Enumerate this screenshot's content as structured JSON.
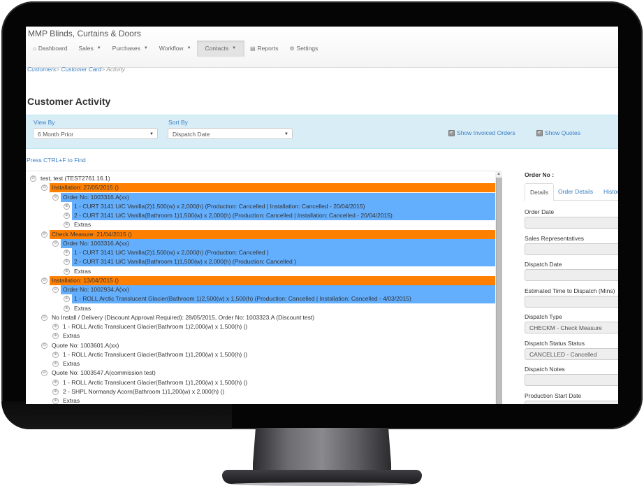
{
  "app": {
    "title": "MMP Blinds, Curtains & Doors"
  },
  "nav": {
    "items": [
      {
        "label": "Dashboard",
        "icon": "home-icon",
        "glyph": "⌂",
        "dropdown": false,
        "active": false
      },
      {
        "label": "Sales",
        "dropdown": true,
        "active": false
      },
      {
        "label": "Purchases",
        "dropdown": true,
        "active": false
      },
      {
        "label": "Workflow",
        "dropdown": true,
        "active": false
      },
      {
        "label": "Contacts",
        "dropdown": true,
        "active": true
      },
      {
        "label": "Reports",
        "icon": "chart-icon",
        "glyph": "▤",
        "dropdown": false,
        "active": false
      },
      {
        "label": "Settings",
        "icon": "gears-icon",
        "glyph": "⚙",
        "dropdown": false,
        "active": false
      }
    ],
    "caret": "▼"
  },
  "breadcrumb": {
    "items": [
      "Customers",
      "Customer Card"
    ],
    "separator": ">",
    "current": "Activity"
  },
  "page": {
    "title": "Customer Activity",
    "find_hint": "Press CTRL+F to Find"
  },
  "filters": {
    "view_by": {
      "label": "View By",
      "value": "6 Month Prior"
    },
    "sort_by": {
      "label": "Sort By",
      "value": "Dispatch Date"
    },
    "dropdown_glyph": "▼",
    "show_invoiced_orders": {
      "label": "Show Invoiced Orders",
      "checked": true
    },
    "show_quotes": {
      "label": "Show Quotes",
      "checked": true
    },
    "check_glyph": "✔"
  },
  "tree": {
    "collapse_glyph": "⊖",
    "expand_glyph": "⊕",
    "rows": [
      {
        "level": 0,
        "type": "customer",
        "text": "test, test (TEST2761.16.1)",
        "state": "collapse"
      },
      {
        "level": 1,
        "type": "dispatch",
        "text": "Installation: 27/05/2015 ()",
        "state": "collapse"
      },
      {
        "level": 2,
        "type": "order",
        "text": "Order No: 1003316.A(xx)",
        "state": "collapse"
      },
      {
        "level": 3,
        "type": "item",
        "text": "1 - CURT 3141 U/C Vanilla(2)1,500(w) x 2,000(h) (Production: Cancelled | Installation: Cancelled - 20/04/2015)",
        "state": "expand"
      },
      {
        "level": 3,
        "type": "item",
        "text": "2 - CURT 3141 U/C Vanilla(Bathroom 1)1,500(w) x 2,000(h) (Production: Cancelled | Installation: Cancelled - 20/04/2015)",
        "state": "expand"
      },
      {
        "level": 3,
        "type": "extras",
        "text": "Extras",
        "state": "expand"
      },
      {
        "level": 1,
        "type": "dispatch",
        "text": "Check Measure: 21/04/2015 ()",
        "state": "collapse"
      },
      {
        "level": 2,
        "type": "order",
        "text": "Order No: 1003316.A(xx)",
        "state": "collapse"
      },
      {
        "level": 3,
        "type": "item",
        "text": "1 - CURT 3141 U/C Vanilla(2)1,500(w) x 2,000(h) (Production: Cancelled )",
        "state": "expand"
      },
      {
        "level": 3,
        "type": "item",
        "text": "2 - CURT 3141 U/C Vanilla(Bathroom 1)1,500(w) x 2,000(h) (Production: Cancelled )",
        "state": "expand"
      },
      {
        "level": 3,
        "type": "extras",
        "text": "Extras",
        "state": "expand"
      },
      {
        "level": 1,
        "type": "dispatch",
        "text": "Installation: 13/04/2015 ()",
        "state": "collapse"
      },
      {
        "level": 2,
        "type": "order",
        "text": "Order No: 1002934.A(xx)",
        "state": "collapse"
      },
      {
        "level": 3,
        "type": "item",
        "text": "1 - ROLL Arctic Translucent Glacier(Bathroom 1)2,500(w) x 1,500(h) (Production: Cancelled | Installation: Cancelled - 4/03/2015)",
        "state": "expand"
      },
      {
        "level": 3,
        "type": "extras",
        "text": "Extras",
        "state": "expand"
      },
      {
        "level": 1,
        "type": "plain",
        "text": "No Install / Delivery (Discount Approval Required): 28/05/2015, Order No: 1003323.A (Discount test)",
        "state": "collapse"
      },
      {
        "level": 2,
        "type": "plain-item",
        "text": "1 - ROLL Arctic Translucent Glacier(Bathroom 1)2,000(w) x 1,500(h) ()",
        "state": "expand"
      },
      {
        "level": 2,
        "type": "plain-item",
        "text": "Extras",
        "state": "expand"
      },
      {
        "level": 1,
        "type": "plain",
        "text": "Quote No: 1003601.A(xx)",
        "state": "collapse"
      },
      {
        "level": 2,
        "type": "plain-item",
        "text": "1 - ROLL Arctic Translucent Glacier(Bathroom 1)1,200(w) x 1,500(h) ()",
        "state": "expand"
      },
      {
        "level": 2,
        "type": "plain-item",
        "text": "Extras",
        "state": "expand"
      },
      {
        "level": 1,
        "type": "plain",
        "text": "Quote No: 1003547.A(commission test)",
        "state": "collapse"
      },
      {
        "level": 2,
        "type": "plain-item",
        "text": "1 - ROLL Arctic Translucent Glacier(Bathroom 1)1,200(w) x 1,500(h) ()",
        "state": "expand"
      },
      {
        "level": 2,
        "type": "plain-item",
        "text": "2 - SHPL Normandy Acorn(Bathroom 1)1,200(w) x 2,000(h) ()",
        "state": "expand"
      },
      {
        "level": 2,
        "type": "plain-item",
        "text": "Extras",
        "state": "expand"
      }
    ]
  },
  "scrollbar": {
    "up_glyph": "▲"
  },
  "detail": {
    "title": "Order No :",
    "tabs": [
      {
        "label": "Details",
        "active": true
      },
      {
        "label": "Order Details",
        "active": false
      },
      {
        "label": "History",
        "active": false
      }
    ],
    "fields": [
      {
        "label": "Order Date",
        "value": ""
      },
      {
        "label": "Sales Representatives",
        "value": ""
      },
      {
        "label": "Dispatch Date",
        "value": ""
      },
      {
        "label": "Estimated Time to Dispatch (Mins)",
        "value": ""
      },
      {
        "label": "Dispatch Type",
        "value": "CHECKM - Check Measure"
      },
      {
        "label": "Dispatch Status Status",
        "value": "CANCELLED - Cancelled"
      },
      {
        "label": "Dispatch Notes",
        "value": ""
      },
      {
        "label": "Production Start Date",
        "value": ""
      }
    ]
  },
  "colors": {
    "dispatch_row": "#ff8000",
    "order_row": "#63aefd",
    "link": "#3a7fc1",
    "filter_panel": "#d9edf7"
  }
}
